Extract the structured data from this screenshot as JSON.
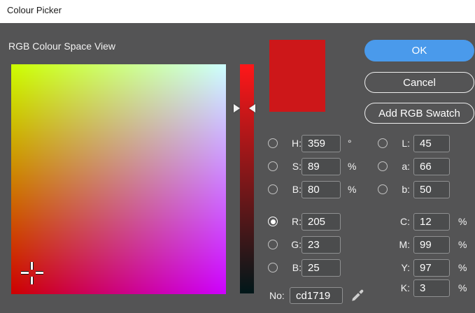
{
  "window": {
    "title": "Colour Picker"
  },
  "dialog": {
    "section_label": "RGB Colour Space View",
    "swatch_color": "#cd1719",
    "accent_color": "#4a9aeb",
    "gradient_corner_colors": {
      "top_left": "#cdff00",
      "top_right": "#cdffff",
      "bottom_left": "#cd0000",
      "bottom_right": "#cd00ff"
    },
    "slider_colors": {
      "top": "#ff1719",
      "bottom": "#001719"
    },
    "buttons": {
      "ok": "OK",
      "cancel": "Cancel",
      "add_swatch": "Add RGB Swatch"
    },
    "fields": {
      "h": {
        "label": "H:",
        "value": "359",
        "suffix": "°",
        "selected": false
      },
      "s": {
        "label": "S:",
        "value": "89",
        "suffix": "%",
        "selected": false
      },
      "b": {
        "label": "B:",
        "value": "80",
        "suffix": "%",
        "selected": false
      },
      "r": {
        "label": "R:",
        "value": "205",
        "selected": true
      },
      "g": {
        "label": "G:",
        "value": "23",
        "selected": false
      },
      "b2": {
        "label": "B:",
        "value": "25",
        "selected": false
      },
      "l": {
        "label": "L:",
        "value": "45",
        "selected": false
      },
      "a": {
        "label": "a:",
        "value": "66",
        "selected": false
      },
      "bb": {
        "label": "b:",
        "value": "50",
        "selected": false
      },
      "c": {
        "label": "C:",
        "value": "12",
        "suffix": "%"
      },
      "m": {
        "label": "M:",
        "value": "99",
        "suffix": "%"
      },
      "y": {
        "label": "Y:",
        "value": "97",
        "suffix": "%"
      },
      "k": {
        "label": "K:",
        "value": "3",
        "suffix": "%"
      },
      "hex": {
        "label": "No:",
        "value": "cd1719"
      }
    },
    "icons": {
      "eyedropper": "eyedropper-icon"
    }
  }
}
